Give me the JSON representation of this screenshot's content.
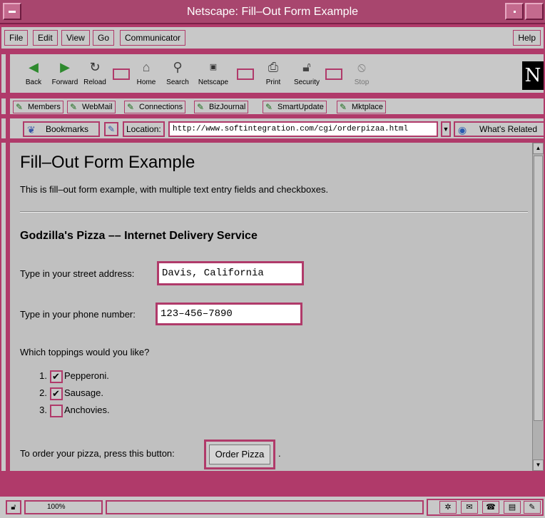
{
  "window": {
    "title": "Netscape: Fill–Out Form Example"
  },
  "menu": {
    "file": "File",
    "edit": "Edit",
    "view": "View",
    "go": "Go",
    "communicator": "Communicator",
    "help": "Help"
  },
  "toolbar": {
    "back": "Back",
    "forward": "Forward",
    "reload": "Reload",
    "home": "Home",
    "search": "Search",
    "netscape": "Netscape",
    "print": "Print",
    "security": "Security",
    "stop": "Stop",
    "logo": "N"
  },
  "personal_toolbar": {
    "members": "Members",
    "webmail": "WebMail",
    "connections": "Connections",
    "bizjournal": "BizJournal",
    "smartupdate": "SmartUpdate",
    "mktplace": "Mktplace"
  },
  "location": {
    "bookmarks": "Bookmarks",
    "label": "Location:",
    "url": "http://www.softintegration.com/cgi/orderpizaa.html",
    "whats_related": "What's Related"
  },
  "page": {
    "title": "Fill–Out Form Example",
    "intro": "This is fill–out form example, with multiple text entry fields and checkboxes.",
    "heading": "Godzilla's Pizza –– Internet Delivery Service",
    "street_label": "Type in your street address:",
    "street_value": "Davis, California",
    "phone_label": "Type in your phone number:",
    "phone_value": "123–456–7890",
    "toppings_question": "Which toppings would you like?",
    "toppings": [
      {
        "num": "1.",
        "label": "Pepperoni.",
        "checked": true
      },
      {
        "num": "2.",
        "label": "Sausage.",
        "checked": true
      },
      {
        "num": "3.",
        "label": "Anchovies.",
        "checked": false
      }
    ],
    "order_label": "To order your pizza, press this button:",
    "order_button": "Order Pizza",
    "order_dot": "."
  },
  "status": {
    "percent": "100%"
  },
  "colors": {
    "frame": "#b03a6a",
    "panel": "#c8c8c8",
    "content_bg": "#c0c0c0"
  }
}
